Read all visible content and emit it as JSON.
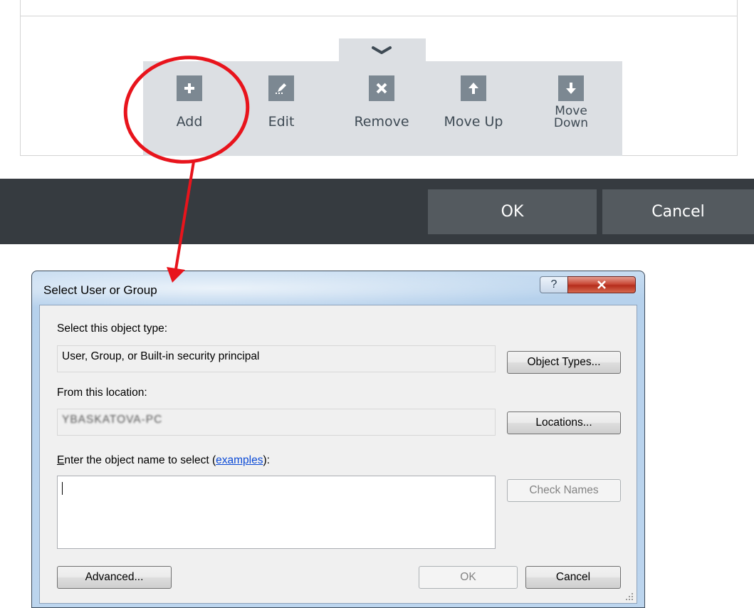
{
  "toolbar": {
    "buttons": [
      {
        "id": "add",
        "label": "Add",
        "icon": "plus-icon"
      },
      {
        "id": "edit",
        "label": "Edit",
        "icon": "pencil-icon"
      },
      {
        "id": "remove",
        "label": "Remove",
        "icon": "x-icon"
      },
      {
        "id": "move-up",
        "label": "Move Up",
        "icon": "arrow-up-icon"
      },
      {
        "id": "move-down",
        "label_line1": "Move",
        "label_line2": "Down",
        "icon": "arrow-down-icon"
      }
    ],
    "collapse_icon": "chevron-down-icon"
  },
  "action_bar": {
    "ok_label": "OK",
    "cancel_label": "Cancel"
  },
  "annotation": {
    "color": "#e8141c"
  },
  "dialog": {
    "title": "Select User or Group",
    "help_glyph": "?",
    "object_type_label": "Select this object type:",
    "object_type_value": "User, Group, or Built-in security principal",
    "object_types_button": "Object Types...",
    "location_label": "From this location:",
    "location_value": "YBASKATOVA-PC",
    "locations_button": "Locations...",
    "enter_label_prefix_underlined": "E",
    "enter_label_rest": "nter the object name to select (",
    "examples_link": "examples",
    "enter_label_suffix": "):",
    "object_name_value": "",
    "check_names_button": "Check Names",
    "advanced_button": "Advanced...",
    "ok_button": "OK",
    "cancel_button": "Cancel"
  }
}
